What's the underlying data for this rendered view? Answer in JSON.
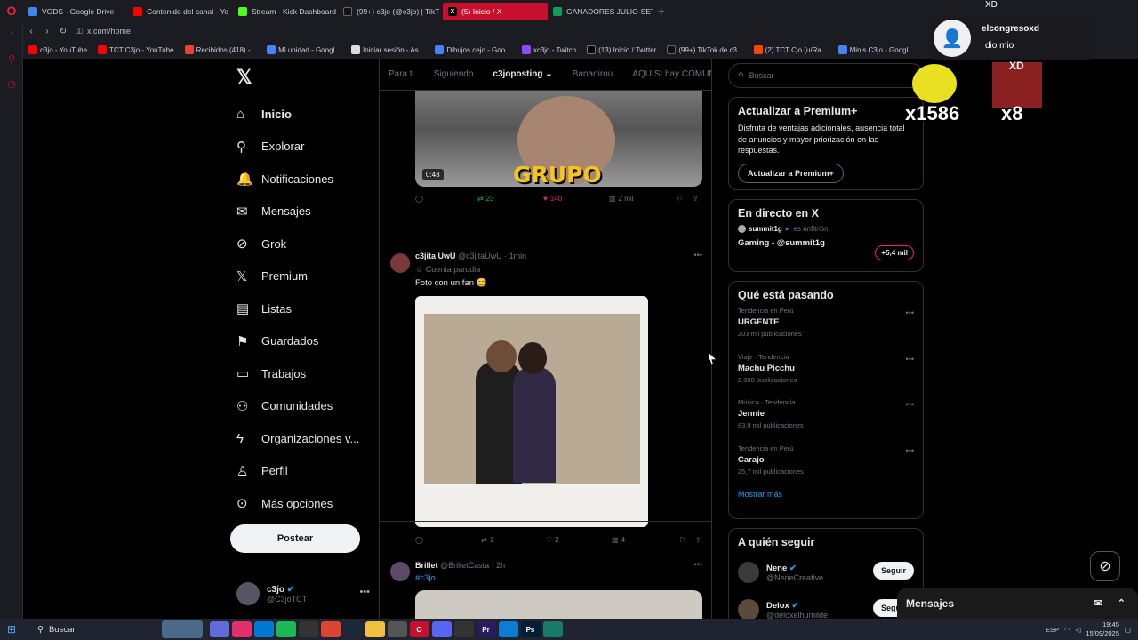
{
  "browser": {
    "tabs": [
      {
        "label": "VODS - Google Drive",
        "color": "#4285f4"
      },
      {
        "label": "Contenido del canal - Yo",
        "color": "#ff0000"
      },
      {
        "label": "Stream - Kick Dashboard",
        "color": "#53fc18"
      },
      {
        "label": "(99+) c3jo (@c3jo) | TikT",
        "color": "#111111"
      },
      {
        "label": "(5) Inicio / X",
        "color": "#000000"
      },
      {
        "label": "GANADORES JULIO-SET",
        "color": "#0f9d58"
      }
    ],
    "new_tab": "+",
    "url": "x.com/home",
    "bookmarks": [
      "c3jo - YouTube",
      "TCT C3jo - YouTube",
      "Recibidos (418) -...",
      "Mi unidad - Googl...",
      "Iniciar sesión - As...",
      "Dibujos cejo - Goo...",
      "xc3jo - Twitch",
      "(13) Inicio / Twitter",
      "(99+) TikTok de c3...",
      "(2) TCT Cjo (u/Ra...",
      "Minis C3jo - Googl..."
    ]
  },
  "leftnav": {
    "items": [
      {
        "label": "Inicio",
        "icon": "⌂"
      },
      {
        "label": "Explorar",
        "icon": "⚲"
      },
      {
        "label": "Notificaciones",
        "icon": "🔔"
      },
      {
        "label": "Mensajes",
        "icon": "✉"
      },
      {
        "label": "Grok",
        "icon": "⊘"
      },
      {
        "label": "Premium",
        "icon": "𝕏"
      },
      {
        "label": "Listas",
        "icon": "▤"
      },
      {
        "label": "Guardados",
        "icon": "⚑"
      },
      {
        "label": "Trabajos",
        "icon": "▭"
      },
      {
        "label": "Comunidades",
        "icon": "⚇"
      },
      {
        "label": "Organizaciones v...",
        "icon": "ϟ"
      },
      {
        "label": "Perfil",
        "icon": "♙"
      },
      {
        "label": "Más opciones",
        "icon": "⊙"
      }
    ],
    "post_button": "Postear",
    "profile_name": "c3jo",
    "profile_handle": "@C3joTCT"
  },
  "feed": {
    "tabs": [
      "Para ti",
      "Siguiendo",
      "c3joposting",
      "Bananirou",
      "AQUISI hay COMUNIDA"
    ],
    "post1": {
      "duration": "0:43",
      "overlay_text": "GRUPO",
      "reposts": "23",
      "likes": "140",
      "views": "2 mil"
    },
    "post2": {
      "name": "c3jita UwU",
      "handle": "@c3jitaUwU · 1min",
      "badge": "Cuenta parodia",
      "text": "Foto con un fan 😅",
      "replies": "",
      "reposts": "1",
      "likes": "2",
      "views": "4"
    },
    "post3": {
      "name": "Brillet",
      "handle": "@BrilletCasta · 2h",
      "text": "#c3jo"
    }
  },
  "right": {
    "search_placeholder": "Buscar",
    "premium": {
      "title": "Actualizar a Premium+",
      "body": "Disfruta de ventajas adicionales, ausencia total de anuncios y mayor priorización en las respuestas.",
      "button": "Actualizar a Premium+"
    },
    "live": {
      "title": "En directo en X",
      "host": "summit1g",
      "host_suffix": "es anfitrión",
      "space": "Gaming - @summit1g",
      "count": "+5,4 mil"
    },
    "trends": {
      "title": "Qué está pasando",
      "items": [
        {
          "context": "Tendencia en Perú",
          "name": "URGENTE",
          "count": "203 mil publicaciones"
        },
        {
          "context": "Viaje · Tendencia",
          "name": "Machu Picchu",
          "count": "2.998 publicaciones"
        },
        {
          "context": "Música · Tendencia",
          "name": "Jennie",
          "count": "83,9 mil publicaciones"
        },
        {
          "context": "Tendencia en Perú",
          "name": "Carajo",
          "count": "25,7 mil publicaciones"
        }
      ],
      "more": "Mostrar más"
    },
    "who": {
      "title": "A quién seguir",
      "items": [
        {
          "name": "Nene",
          "handle": "@NeneCreative",
          "button": "Seguir"
        },
        {
          "name": "Delox",
          "handle": "@deloxelhumilde",
          "button": "Seguir"
        }
      ]
    }
  },
  "messages": {
    "label": "Mensajes"
  },
  "overlay": {
    "name": "elcongresoxd",
    "message": "dio mio",
    "top_label": "XD",
    "sticker1": "x1586",
    "sticker2": "x8",
    "sticker2_label": "XD"
  },
  "taskbar": {
    "search": "Buscar",
    "lang": "ESP",
    "time": "19:45",
    "date": "15/09/2025"
  }
}
